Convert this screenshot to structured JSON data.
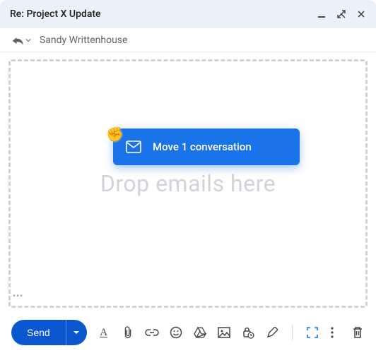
{
  "titlebar": {
    "title": "Re: Project X Update"
  },
  "recipients": {
    "to": "Sandy Writtenhouse"
  },
  "drag": {
    "label": "Move 1 conversation"
  },
  "dropzone": {
    "placeholder": "Drop emails here"
  },
  "toolbar": {
    "send_label": "Send"
  }
}
